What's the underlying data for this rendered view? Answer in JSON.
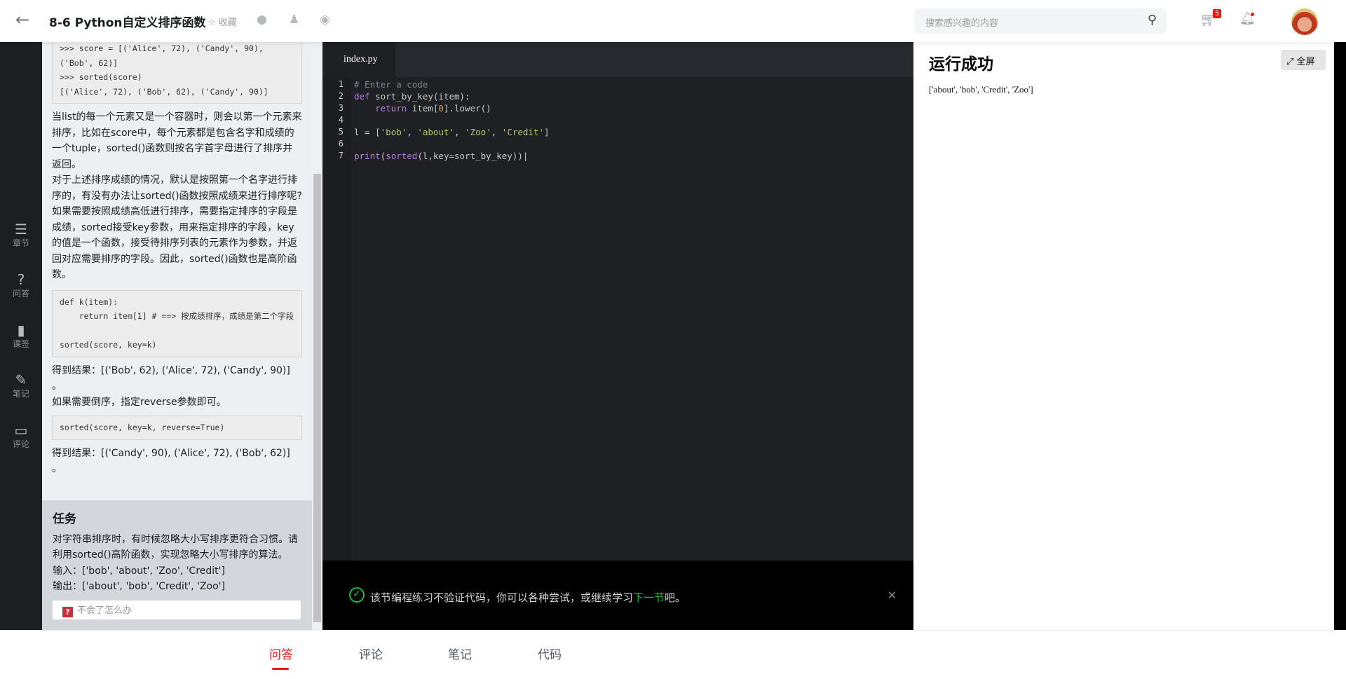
{
  "header": {
    "title": "8-6 Python自定义排序函数",
    "favorite": "收藏",
    "search_placeholder": "搜索感兴趣的内容",
    "cart_count": "5"
  },
  "sidebar": {
    "items": [
      {
        "label": "章节",
        "icon": "☰"
      },
      {
        "label": "问答",
        "icon": "?"
      },
      {
        "label": "课签",
        "icon": "▮"
      },
      {
        "label": "笔记",
        "icon": "✎"
      },
      {
        "label": "评论",
        "icon": "▭"
      }
    ]
  },
  "article": {
    "code1": ">>> score = [('Alice', 72), ('Candy', 90), ('Bob', 62)]\n>>> sorted(score)\n[('Alice', 72), ('Bob', 62), ('Candy', 90)]",
    "p1": "当list的每一个元素又是一个容器时，则会以第一个元素来排序，比如在score中，每个元素都是包含名字和成绩的一个tuple，sorted()函数则按名字首字母进行了排序并返回。",
    "p2": "对于上述排序成绩的情况，默认是按照第一个名字进行排序的，有没有办法让sorted()函数按照成绩来进行排序呢?",
    "p3": "如果需要按照成绩高低进行排序，需要指定排序的字段是成绩，sorted接受key参数，用来指定排序的字段，key的值是一个函数，接受待排序列表的元素作为参数，并返回对应需要排序的字段。因此，sorted()函数也是高阶函数。",
    "code2": "def k(item):\n    return item[1] # ==> 按成绩排序，成绩是第二个字段\n\nsorted(score, key=k)",
    "p4": "得到结果：[('Bob', 62), ('Alice', 72), ('Candy', 90)] 。",
    "p5": "如果需要倒序，指定reverse参数即可。",
    "code3": "sorted(score, key=k, reverse=True)",
    "p6": "得到结果：[('Candy', 90), ('Alice', 72), ('Bob', 62)] 。"
  },
  "task": {
    "title": "任务",
    "desc": "对字符串排序时，有时候忽略大小写排序更符合习惯。请利用sorted()高阶函数，实现忽略大小写排序的算法。",
    "input": "输入：['bob', 'about', 'Zoo', 'Credit']",
    "output": "输出：['about', 'bob', 'Credit', 'Zoo']",
    "help": "不会了怎么办"
  },
  "editor": {
    "tab": "index.py",
    "line_numbers": [
      "1",
      "2",
      "3",
      "4",
      "5",
      "6",
      "7"
    ]
  },
  "notice": {
    "text_before": "该节编程练习不验证代码，你可以各种尝试，或继续学习",
    "link": "下一节",
    "text_after": "吧。"
  },
  "output": {
    "title": "运行成功",
    "fullscreen": "全屏",
    "result": "['about', 'bob', 'Credit', 'Zoo']"
  },
  "bottom_tabs": [
    "问答",
    "评论",
    "笔记",
    "代码"
  ],
  "colors": {
    "accent": "#f01414",
    "success": "#1fb83e"
  }
}
